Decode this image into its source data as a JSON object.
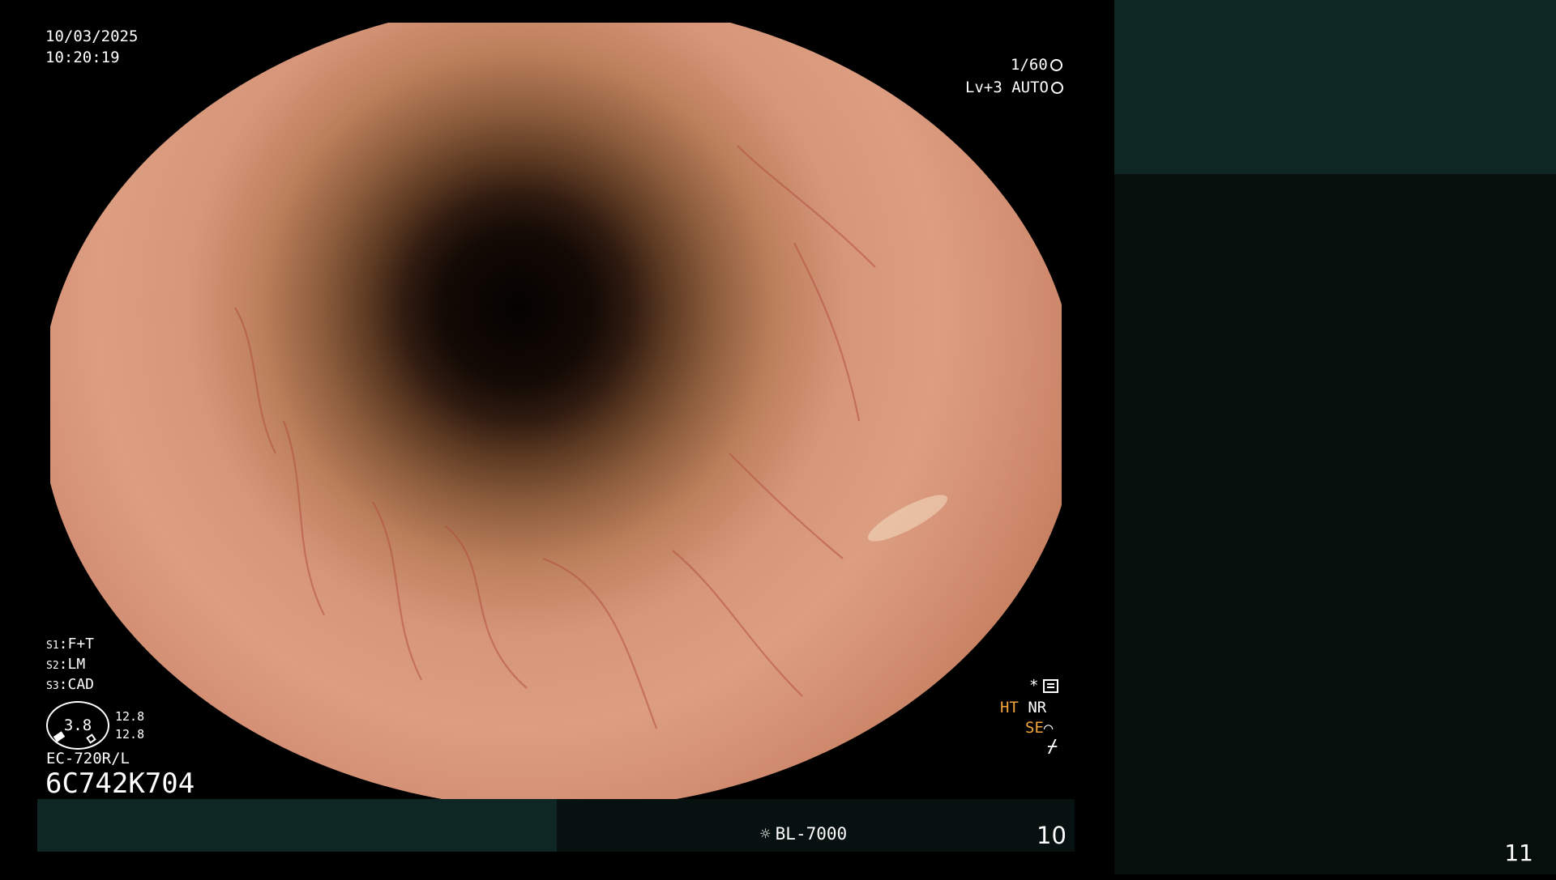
{
  "osd": {
    "date": "10/03/2025",
    "time": "10:20:19",
    "shutter": "1/60",
    "level_auto": "Lv+3 AUTO",
    "s1_label": "S1",
    "s1_value": ":F+T",
    "s2_label": "S2",
    "s2_value": ":LM",
    "s3_label": "S3",
    "s3_value": ":CAD",
    "gauge_value": "3.8",
    "value_a": "12.8",
    "value_b": "12.8",
    "scope_model": "EC-720R/L",
    "serial": "6C742K704",
    "star": "*",
    "ht": "HT",
    "nr": "NR",
    "se": "SE",
    "misc_glyph": "⌿"
  },
  "bottom_bar": {
    "light_source": "BL-7000",
    "frame_number": "10"
  },
  "right_panel": {
    "page_number": "11"
  },
  "colors": {
    "background": "#000000",
    "panel_teal": "#0e2624",
    "panel_dark": "#070f0d",
    "accent_orange": "#f2a53a",
    "mucosa": "#dc9d80"
  },
  "icons": {
    "shutter": "shutter-icon",
    "iris": "iris-icon",
    "settings_list": "list-icon",
    "light_source": "sun-icon"
  }
}
